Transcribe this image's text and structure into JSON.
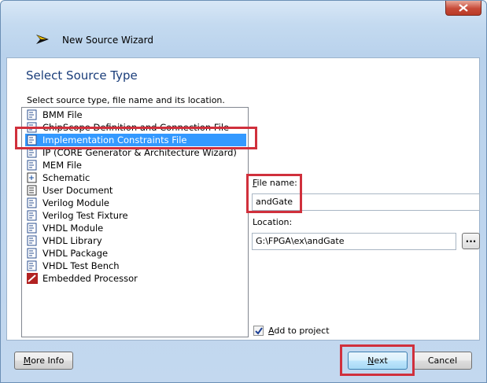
{
  "window": {
    "title": "New Source Wizard"
  },
  "page": {
    "heading": "Select Source Type",
    "instruction": "Select source type, file name and its location."
  },
  "source_types": [
    {
      "label": "BMM File",
      "icon": "bmm-file-icon",
      "selected": false
    },
    {
      "label": "ChipScope Definition and Connection File",
      "icon": "chipscope-icon",
      "selected": false
    },
    {
      "label": "Implementation Constraints File",
      "icon": "constraints-file-icon",
      "selected": true
    },
    {
      "label": "IP (CORE Generator & Architecture Wizard)",
      "icon": "ip-core-icon",
      "selected": false
    },
    {
      "label": "MEM File",
      "icon": "mem-file-icon",
      "selected": false
    },
    {
      "label": "Schematic",
      "icon": "schematic-icon",
      "selected": false
    },
    {
      "label": "User Document",
      "icon": "document-icon",
      "selected": false
    },
    {
      "label": "Verilog Module",
      "icon": "verilog-module-icon",
      "selected": false
    },
    {
      "label": "Verilog Test Fixture",
      "icon": "verilog-test-icon",
      "selected": false
    },
    {
      "label": "VHDL Module",
      "icon": "vhdl-module-icon",
      "selected": false
    },
    {
      "label": "VHDL Library",
      "icon": "vhdl-library-icon",
      "selected": false
    },
    {
      "label": "VHDL Package",
      "icon": "vhdl-package-icon",
      "selected": false
    },
    {
      "label": "VHDL Test Bench",
      "icon": "vhdl-testbench-icon",
      "selected": false
    },
    {
      "label": "Embedded Processor",
      "icon": "embedded-processor-icon",
      "selected": false
    }
  ],
  "form": {
    "file_name_label": "File name:",
    "file_name_value": "andGate",
    "location_label": "Location:",
    "location_value": "G:\\FPGA\\ex\\andGate",
    "browse_label": "...",
    "add_to_project_label": "Add to project",
    "add_to_project_checked": true
  },
  "buttons": {
    "more_info": "More Info",
    "next": "Next",
    "cancel": "Cancel"
  },
  "colors": {
    "selection": "#3399ff",
    "highlight": "#d0303c",
    "heading": "#1a3d7a"
  }
}
